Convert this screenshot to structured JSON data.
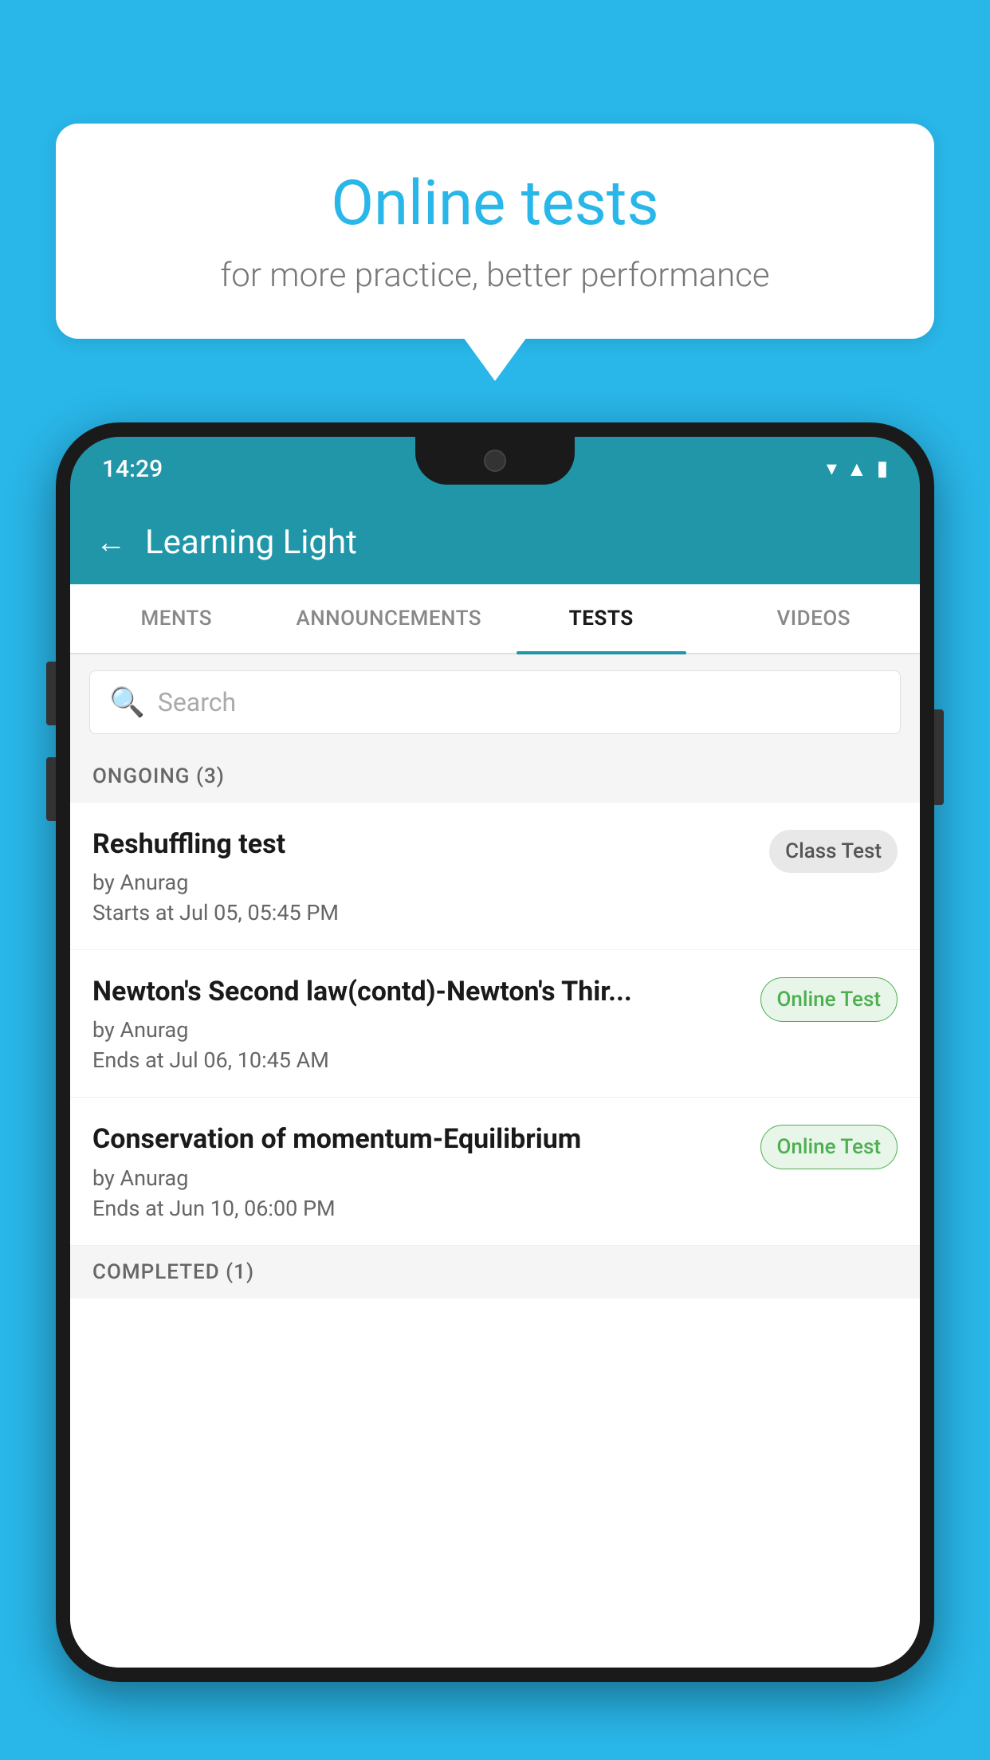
{
  "background": {
    "color": "#29b6e8"
  },
  "speech_bubble": {
    "title": "Online tests",
    "subtitle": "for more practice, better performance"
  },
  "status_bar": {
    "time": "14:29",
    "icons": [
      "wifi",
      "signal",
      "battery"
    ]
  },
  "app_header": {
    "title": "Learning Light",
    "back_label": "←"
  },
  "tabs": [
    {
      "label": "MENTS",
      "active": false
    },
    {
      "label": "ANNOUNCEMENTS",
      "active": false
    },
    {
      "label": "TESTS",
      "active": true
    },
    {
      "label": "VIDEOS",
      "active": false
    }
  ],
  "search": {
    "placeholder": "Search"
  },
  "sections": [
    {
      "header": "ONGOING (3)",
      "items": [
        {
          "name": "Reshuffling test",
          "author": "by Anurag",
          "date": "Starts at  Jul 05, 05:45 PM",
          "badge": "Class Test",
          "badge_type": "class"
        },
        {
          "name": "Newton's Second law(contd)-Newton's Thir...",
          "author": "by Anurag",
          "date": "Ends at  Jul 06, 10:45 AM",
          "badge": "Online Test",
          "badge_type": "online"
        },
        {
          "name": "Conservation of momentum-Equilibrium",
          "author": "by Anurag",
          "date": "Ends at  Jun 10, 06:00 PM",
          "badge": "Online Test",
          "badge_type": "online"
        }
      ]
    }
  ],
  "completed_section": {
    "header": "COMPLETED (1)"
  }
}
